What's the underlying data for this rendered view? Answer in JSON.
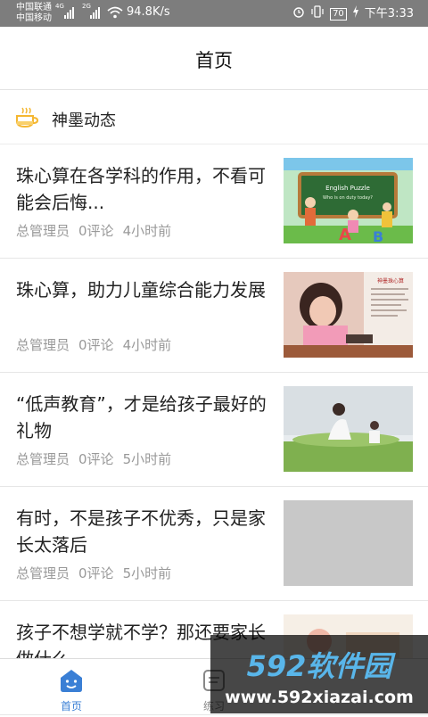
{
  "status_bar": {
    "carrier_1": "中国联通",
    "carrier_2": "中国移动",
    "net_1": "4G",
    "net_2": "2G",
    "speed": "94.8K/s",
    "battery": "70",
    "time": "下午3:33"
  },
  "header": {
    "title": "首页"
  },
  "section": {
    "title": "神墨动态",
    "icon": "cup-icon"
  },
  "feed": [
    {
      "title": "珠心算在各学科的作用，不看可能会后悔...",
      "author": "总管理员",
      "comments": "0评论",
      "time": "4小时前"
    },
    {
      "title": "珠心算，助力儿童综合能力发展",
      "author": "总管理员",
      "comments": "0评论",
      "time": "4小时前"
    },
    {
      "title": "“低声教育”，才是给孩子最好的礼物",
      "author": "总管理员",
      "comments": "0评论",
      "time": "5小时前"
    },
    {
      "title": "有时，不是孩子不优秀，只是家长太落后",
      "author": "总管理员",
      "comments": "0评论",
      "time": "5小时前"
    },
    {
      "title": "孩子不想学就不学？那还要家长做什么",
      "author": "",
      "comments": "",
      "time": ""
    }
  ],
  "thumb_text": {
    "board_line_1": "English Puzzle",
    "board_line_2": "Who is on duty today?",
    "poster_title": "神墨珠心算"
  },
  "tabs": [
    {
      "label": "首页",
      "icon": "home-face-icon",
      "active": true
    },
    {
      "label": "练习",
      "icon": "practice-icon",
      "active": false
    },
    {
      "label": "",
      "icon": "unknown-icon",
      "active": false
    }
  ],
  "watermark": {
    "logo": "592软件园",
    "url": "www.592xiazai.com"
  },
  "colors": {
    "accent": "#3a7fd5",
    "status_bar": "#7d7d7d",
    "meta_text": "#999999"
  }
}
